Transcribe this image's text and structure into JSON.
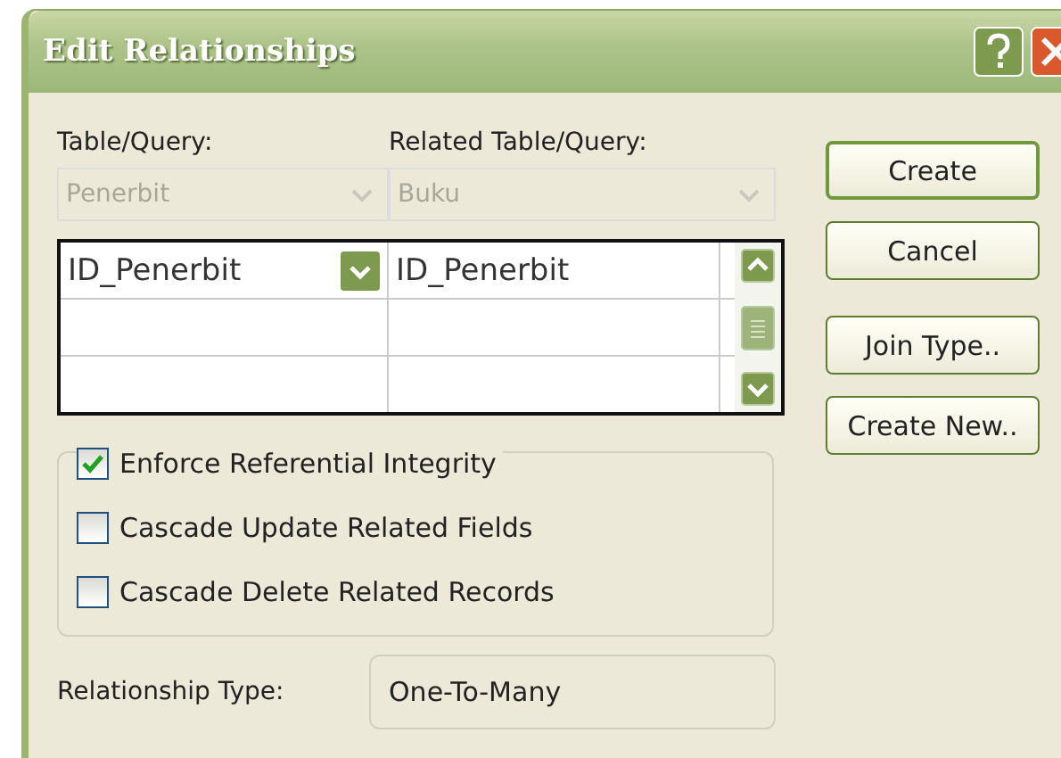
{
  "window": {
    "title": "Edit Relationships"
  },
  "table_query": {
    "label": "Table/Query:",
    "value": "Penerbit",
    "disabled": true
  },
  "related_table_query": {
    "label": "Related Table/Query:",
    "value": "Buku",
    "disabled": true
  },
  "field_grid": {
    "rows": [
      {
        "field": "ID_Penerbit",
        "related_field": "ID_Penerbit"
      }
    ]
  },
  "options": [
    {
      "label": "Enforce Referential Integrity",
      "checked": true
    },
    {
      "label": "Cascade Update Related Fields",
      "checked": false
    },
    {
      "label": "Cascade Delete Related Records",
      "checked": false
    }
  ],
  "relationship_type": {
    "label": "Relationship Type:",
    "value": "One-To-Many"
  },
  "buttons": [
    {
      "label": "Create",
      "default": true
    },
    {
      "label": "Cancel",
      "default": false
    },
    {
      "label": "Join Type..",
      "default": false
    },
    {
      "label": "Create New..",
      "default": false
    }
  ]
}
